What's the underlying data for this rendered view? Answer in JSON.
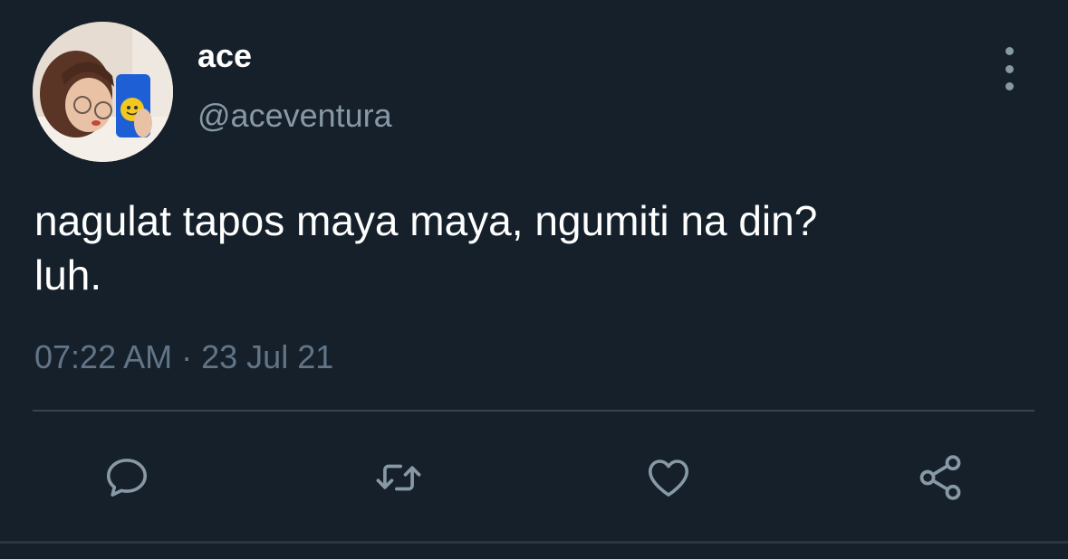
{
  "author": {
    "display_name": "ace",
    "handle": "@aceventura",
    "avatar_icon": "profile-photo"
  },
  "tweet": {
    "text": "nagulat tapos maya maya, ngumiti na din?\nluh.",
    "time": "07:22 AM",
    "separator": "·",
    "date": "23 Jul 21"
  },
  "actions": {
    "reply_icon": "comment-icon",
    "retweet_icon": "retweet-icon",
    "like_icon": "heart-icon",
    "share_icon": "share-icon"
  },
  "colors": {
    "background": "#15202b",
    "primary_text": "#ffffff",
    "secondary_text": "#8899a6",
    "divider": "#38444d"
  }
}
